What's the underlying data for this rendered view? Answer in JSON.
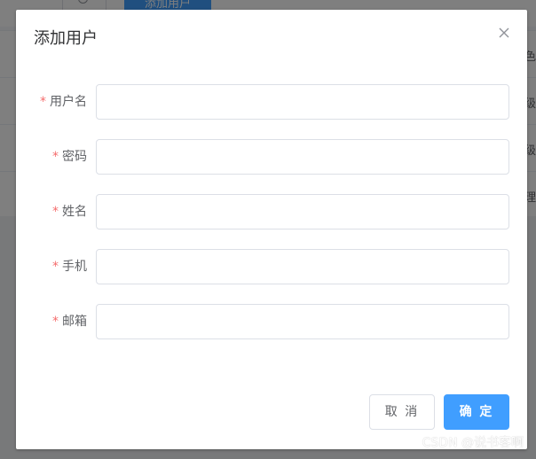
{
  "background": {
    "add_button_label": "添加用户",
    "table_cells": [
      "角色",
      "超级",
      "超级",
      "经理"
    ]
  },
  "dialog": {
    "title": "添加用户",
    "close_icon": "close-icon",
    "fields": [
      {
        "label": "用户名",
        "required": true,
        "value": "",
        "placeholder": ""
      },
      {
        "label": "密码",
        "required": true,
        "value": "",
        "placeholder": ""
      },
      {
        "label": "姓名",
        "required": true,
        "value": "",
        "placeholder": ""
      },
      {
        "label": "手机",
        "required": true,
        "value": "",
        "placeholder": ""
      },
      {
        "label": "邮箱",
        "required": true,
        "value": "",
        "placeholder": ""
      }
    ],
    "required_mark": "*",
    "cancel_label": "取 消",
    "confirm_label": "确 定"
  },
  "watermark": "CSDN @说书客啊",
  "colors": {
    "primary": "#409eff",
    "required": "#f56c6c",
    "label": "#606266",
    "border": "#dcdfe6",
    "mask": "rgba(0,0,0,0.5)"
  }
}
